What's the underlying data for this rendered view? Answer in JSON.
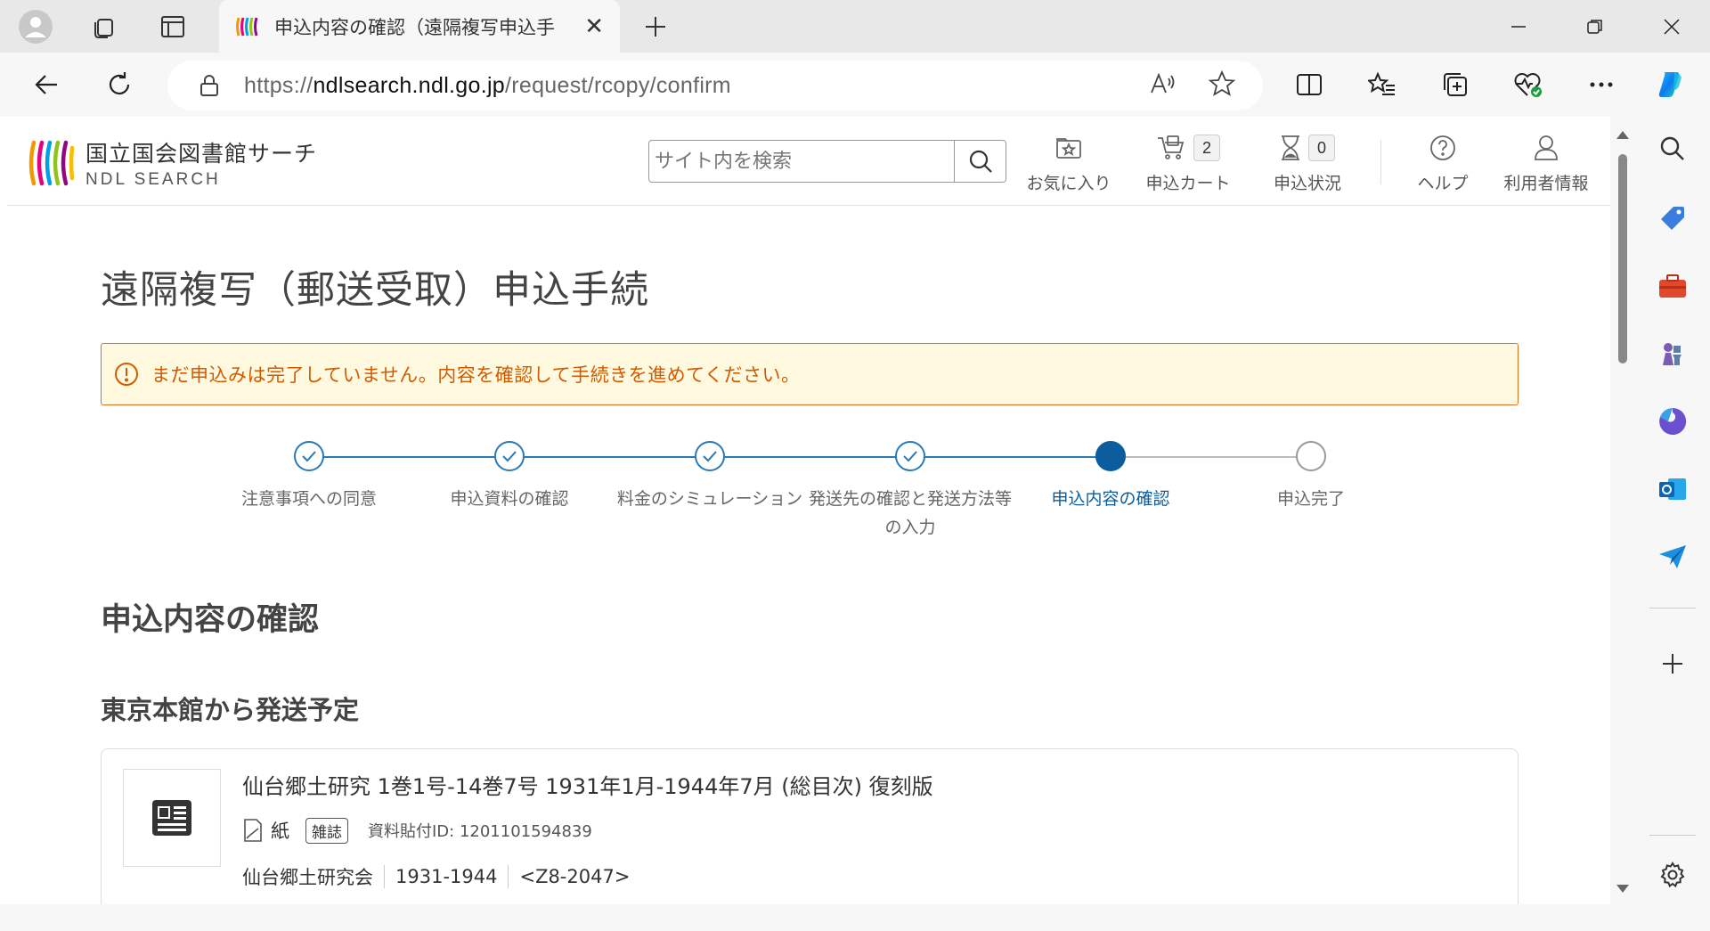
{
  "browser": {
    "tab_title": "申込内容の確認（遠隔複写申込手",
    "url_prefix": "https://",
    "url_domain": "ndlsearch.ndl.go.jp",
    "url_path": "/request/rcopy/confirm"
  },
  "header": {
    "logo_jp": "国立国会図書館サーチ",
    "logo_en": "NDL SEARCH",
    "search_placeholder": "サイト内を検索",
    "nav": {
      "favorites": "お気に入り",
      "cart": "申込カート",
      "cart_count": "2",
      "status": "申込状況",
      "status_count": "0",
      "help": "ヘルプ",
      "user": "利用者情報"
    }
  },
  "page": {
    "title": "遠隔複写（郵送受取）申込手続",
    "alert": "まだ申込みは完了していません。内容を確認して手続きを進めてください。",
    "steps": [
      {
        "label": "注意事項への同意",
        "state": "done"
      },
      {
        "label": "申込資料の確認",
        "state": "done"
      },
      {
        "label": "料金のシミュレーション",
        "state": "done"
      },
      {
        "label": "発送先の確認と発送方法等の入力",
        "state": "done"
      },
      {
        "label": "申込内容の確認",
        "state": "current"
      },
      {
        "label": "申込完了",
        "state": "pending"
      }
    ],
    "section_title": "申込内容の確認",
    "ship_from": "東京本館から発送予定",
    "item": {
      "title": "仙台郷土研究 1巻1号-14巻7号 1931年1月-1944年7月 (総目次) 復刻版",
      "format": "紙",
      "tag": "雑誌",
      "id_label": "資料貼付ID: 1201101594839",
      "publisher": "仙台郷土研究会",
      "years": "1931-1944",
      "callno": "<Z8-2047>"
    }
  },
  "colors": {
    "accent": "#0b5d9e",
    "step_line": "#2a7ab8",
    "alert_text": "#d25a00",
    "alert_bg": "#fff9e0"
  }
}
